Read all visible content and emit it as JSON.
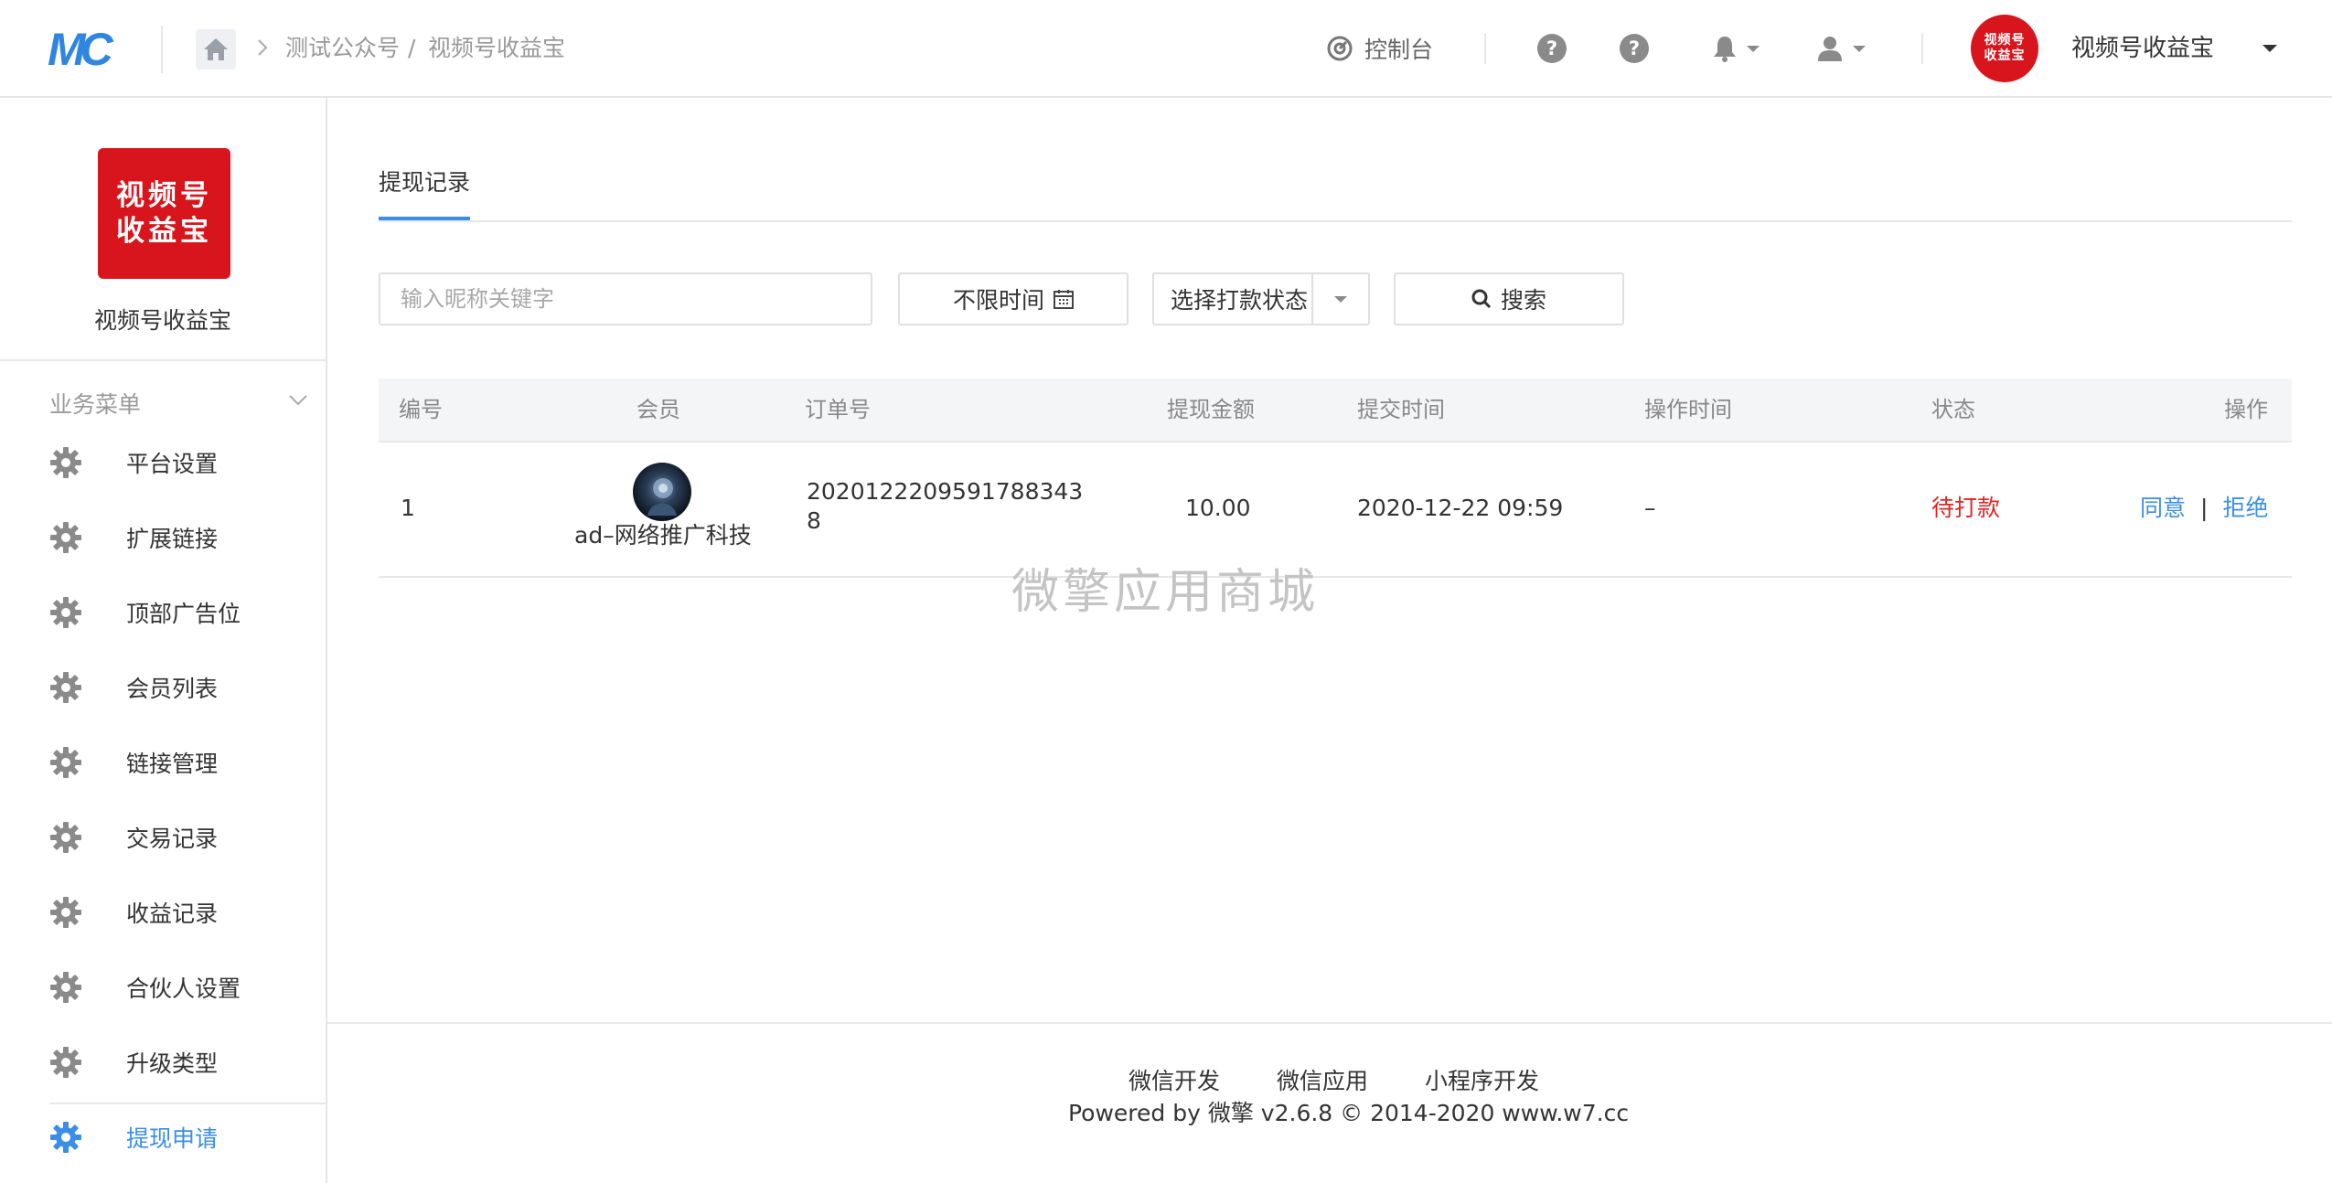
{
  "header": {
    "logo_text": "MC",
    "breadcrumb": [
      "测试公众号",
      "/",
      "视频号收益宝"
    ],
    "console_label": "控制台",
    "account_avatar_text": [
      "视频号",
      "收益宝"
    ],
    "account_name": "视频号收益宝"
  },
  "sidebar": {
    "app_logo_text": [
      "视频号",
      "收益宝"
    ],
    "app_name": "视频号收益宝",
    "menu_title": "业务菜单",
    "items": [
      {
        "label": "平台设置",
        "icon": "gear-icon"
      },
      {
        "label": "扩展链接",
        "icon": "gear-icon"
      },
      {
        "label": "顶部广告位",
        "icon": "gear-icon"
      },
      {
        "label": "会员列表",
        "icon": "gear-icon"
      },
      {
        "label": "链接管理",
        "icon": "gear-icon"
      },
      {
        "label": "交易记录",
        "icon": "gear-icon"
      },
      {
        "label": "收益记录",
        "icon": "gear-icon"
      },
      {
        "label": "合伙人设置",
        "icon": "gear-icon"
      },
      {
        "label": "升级类型",
        "icon": "gear-icon"
      },
      {
        "label": "提现申请",
        "icon": "gear-icon",
        "active": true
      }
    ]
  },
  "main": {
    "tab_label": "提现记录",
    "filters": {
      "search_placeholder": "输入昵称关键字",
      "time_label": "不限时间",
      "status_label": "选择打款状态",
      "search_button": "搜索"
    },
    "table": {
      "headers": {
        "id": "编号",
        "member": "会员",
        "order_no": "订单号",
        "amount": "提现金额",
        "submit_time": "提交时间",
        "op_time": "操作时间",
        "status": "状态",
        "actions": "操作"
      },
      "rows": [
        {
          "id": "1",
          "member_name": "ad–网络推广科技",
          "order_no_line1": "2020122209591788343",
          "order_no_line2": "8",
          "amount": "10.00",
          "submit_time": "2020-12-22 09:59",
          "op_time": "–",
          "status": "待打款",
          "action_agree": "同意",
          "action_sep": "|",
          "action_reject": "拒绝"
        }
      ]
    }
  },
  "watermark": "微擎应用商城",
  "footer": {
    "links": [
      "微信开发",
      "微信应用",
      "小程序开发"
    ],
    "copyright": "Powered by 微擎 v2.6.8 © 2014-2020 www.w7.cc"
  },
  "colors": {
    "accent": "#3a8ee6",
    "brand_red": "#d8151c",
    "status_pending": "#e32424"
  }
}
